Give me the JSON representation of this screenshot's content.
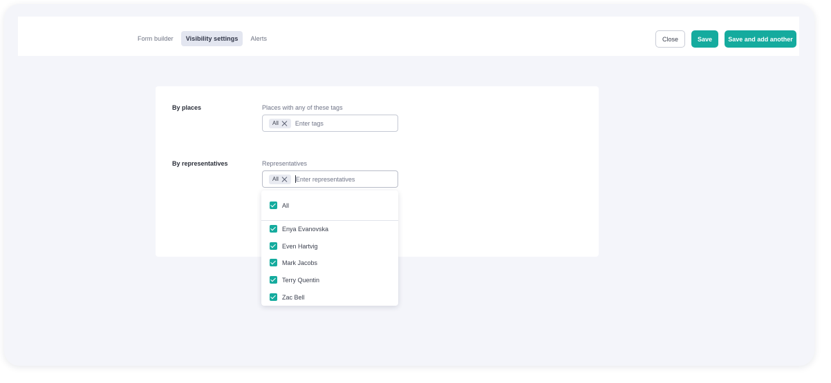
{
  "tabs": [
    {
      "label": "Form builder",
      "active": false
    },
    {
      "label": "Visibility settings",
      "active": true
    },
    {
      "label": "Alerts",
      "active": false
    }
  ],
  "actions": {
    "close_label": "Close",
    "save_label": "Save",
    "save_another_label": "Save and add another"
  },
  "places": {
    "section_label": "By places",
    "field_label": "Places with any of these tags",
    "chip_label": "All",
    "placeholder": "Enter tags"
  },
  "representatives": {
    "section_label": "By representatives",
    "field_label": "Representatives",
    "chip_label": "All",
    "placeholder": "Enter representatives"
  },
  "dropdown": {
    "all_label": "All",
    "items": [
      {
        "label": "Enya Evanovska",
        "checked": true
      },
      {
        "label": "Even Hartvig",
        "checked": true
      },
      {
        "label": "Mark Jacobs",
        "checked": true
      },
      {
        "label": "Terry Quentin",
        "checked": true
      },
      {
        "label": "Zac Bell",
        "checked": true
      }
    ]
  },
  "colors": {
    "accent": "#15ab9e",
    "background": "#f4f5fa"
  }
}
